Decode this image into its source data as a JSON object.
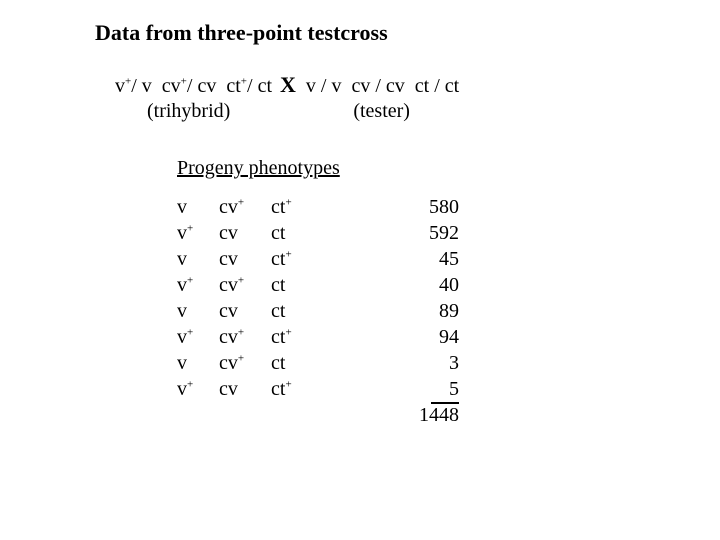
{
  "title": "Data from three-point testcross",
  "cross": {
    "trihybrid_a1": "v",
    "trihybrid_a2": "v",
    "trihybrid_b1": "cv",
    "trihybrid_b2": "cv",
    "trihybrid_c1": "ct",
    "trihybrid_c2": "ct",
    "plus": "+",
    "slash": "/",
    "X": "X",
    "tester_a1": "v",
    "tester_a2": "v",
    "tester_b1": "cv",
    "tester_b2": "cv",
    "tester_c1": "ct",
    "tester_c2": "ct",
    "trihy_label": "(trihybrid)",
    "tester_label": "(tester)"
  },
  "progeny_heading": "Progeny phenotypes",
  "rows": [
    {
      "v": "v",
      "vp": false,
      "cv": "cv",
      "cvp": true,
      "ct": "ct",
      "ctp": true,
      "n": "580"
    },
    {
      "v": "v",
      "vp": true,
      "cv": "cv",
      "cvp": false,
      "ct": "ct",
      "ctp": false,
      "n": "592"
    },
    {
      "v": "v",
      "vp": false,
      "cv": "cv",
      "cvp": false,
      "ct": "ct",
      "ctp": true,
      "n": "45"
    },
    {
      "v": "v",
      "vp": true,
      "cv": "cv",
      "cvp": true,
      "ct": "ct",
      "ctp": false,
      "n": "40"
    },
    {
      "v": "v",
      "vp": false,
      "cv": "cv",
      "cvp": false,
      "ct": "ct",
      "ctp": false,
      "n": "89"
    },
    {
      "v": "v",
      "vp": true,
      "cv": "cv",
      "cvp": true,
      "ct": "ct",
      "ctp": true,
      "n": "94"
    },
    {
      "v": "v",
      "vp": false,
      "cv": "cv",
      "cvp": true,
      "ct": "ct",
      "ctp": false,
      "n": "3"
    },
    {
      "v": "v",
      "vp": true,
      "cv": "cv",
      "cvp": false,
      "ct": "ct",
      "ctp": true,
      "n": "5"
    }
  ],
  "total": "1448"
}
